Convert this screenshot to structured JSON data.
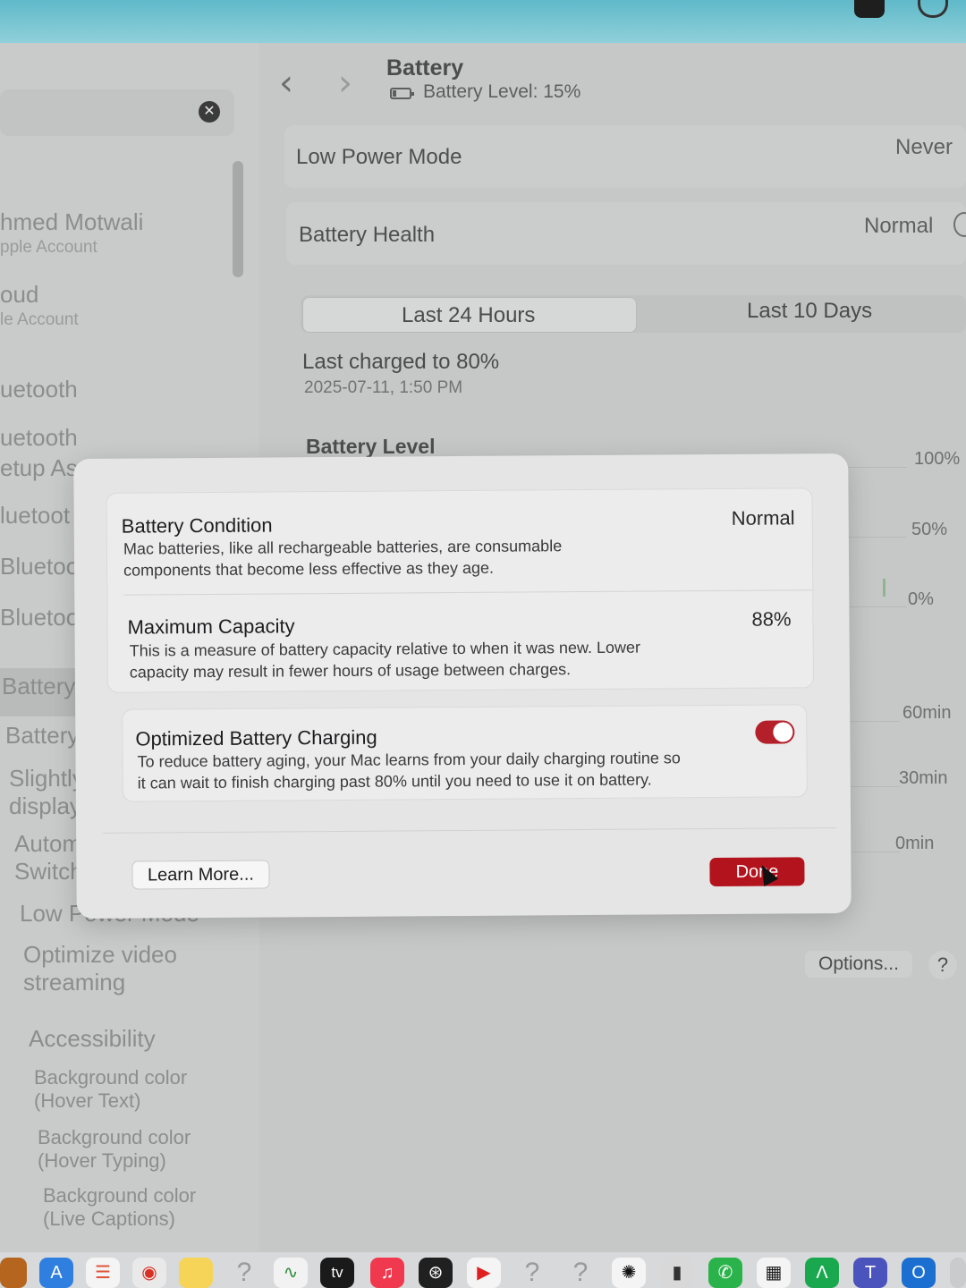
{
  "header": {
    "title": "Battery",
    "subtitle": "Battery Level: 15%"
  },
  "sidebar": {
    "items": [
      {
        "title": "hmed Motwali",
        "subtitle": "pple Account"
      },
      {
        "title": "oud",
        "subtitle": "le Account"
      },
      {
        "title": "uetooth"
      },
      {
        "title": "uetooth"
      },
      {
        "title": "etup As"
      },
      {
        "title": "luetoot"
      },
      {
        "title": "Bluetoot"
      },
      {
        "title": "Bluetoot"
      },
      {
        "title": "Battery"
      },
      {
        "title": "Battery H"
      },
      {
        "title": "Slightly d",
        "subtitle": "display d"
      },
      {
        "title": "Automat",
        "subtitle": "Switchin"
      },
      {
        "title": "Low Power Mode"
      },
      {
        "title": "Optimize video",
        "subtitle": "streaming"
      },
      {
        "title": "Accessibility"
      },
      {
        "title": "Background color",
        "subtitle": "(Hover Text)"
      },
      {
        "title": "Background color",
        "subtitle": "(Hover Typing)"
      },
      {
        "title": "Background color",
        "subtitle": "(Live Captions)"
      }
    ]
  },
  "main": {
    "low_power_mode": {
      "label": "Low Power Mode",
      "value": "Never"
    },
    "battery_health": {
      "label": "Battery Health",
      "value": "Normal"
    },
    "segments": [
      "Last 24 Hours",
      "Last 10 Days"
    ],
    "selected_segment": "Last 24 Hours",
    "last_charged": "Last charged to 80%",
    "last_charged_date": "2025-07-11, 1:50 PM",
    "section_title": "Battery Level",
    "level_axis": [
      "100%",
      "50%",
      "0%"
    ],
    "usage_axis": [
      "60min",
      "30min",
      "0min"
    ],
    "options_label": "Options...",
    "help_label": "?"
  },
  "dialog": {
    "condition": {
      "title": "Battery Condition",
      "value": "Normal",
      "description_1": "Mac batteries, like all rechargeable batteries, are consumable",
      "description_2": "components that become less effective as they age."
    },
    "capacity": {
      "title": "Maximum Capacity",
      "value": "88%",
      "description_1": "This is a measure of battery capacity relative to when it was new. Lower",
      "description_2": "capacity may result in fewer hours of usage between charges."
    },
    "optimized": {
      "title": "Optimized Battery Charging",
      "enabled": true,
      "description_1": "To reduce battery aging, your Mac learns from your daily charging routine so",
      "description_2": "it can wait to finish charging past 80% until you need to use it on battery."
    },
    "learn_more": "Learn More...",
    "done": "Done"
  },
  "dock": {
    "items": [
      "app-store-icon",
      "reminders-icon",
      "chrome-icon",
      "notes-icon",
      "unknown-app-icon",
      "activity-monitor-icon",
      "tv-icon",
      "music-icon",
      "chatgpt-icon",
      "youtube-icon",
      "unknown-app-icon",
      "unknown-app-icon",
      "openai-icon",
      "phone-icon",
      "whatsapp-icon",
      "numbers-icon",
      "xcode-icon",
      "teams-icon",
      "outlook-icon"
    ],
    "tv_label": "tv"
  },
  "colors": {
    "accent": "#b3131d",
    "toggle_on": "#b3202a"
  }
}
